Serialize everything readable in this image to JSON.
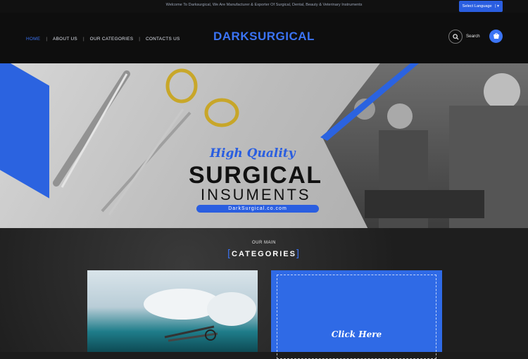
{
  "topbar": {
    "welcome": "Welcome To Darksurgical, We Are Manufacturer & Exporter Of Surgical, Dental, Beauty & Veterinary Instruments",
    "language_label": "Select Language"
  },
  "nav": {
    "items": [
      {
        "label": "HOME"
      },
      {
        "label": "ABOUT US"
      },
      {
        "label": "OUR CATEGORIES"
      },
      {
        "label": "CONTACTS US"
      }
    ]
  },
  "logo": "DARKSURGICAL",
  "header": {
    "search_label": "Search",
    "cart_icon": "cart-icon",
    "search_icon": "search-icon"
  },
  "hero": {
    "tagline": "High Quality",
    "title": "SURGICAL",
    "subtitle": "INSUMENTS",
    "url": "DarkSurgical.co.com"
  },
  "categories": {
    "eyebrow": "OUR MAIN",
    "title": "CATEGORIES",
    "card_cta": "Click Here"
  },
  "colors": {
    "accent": "#3b74f5",
    "header_bg": "#0e0e0e",
    "topbar_bg": "#111111"
  }
}
